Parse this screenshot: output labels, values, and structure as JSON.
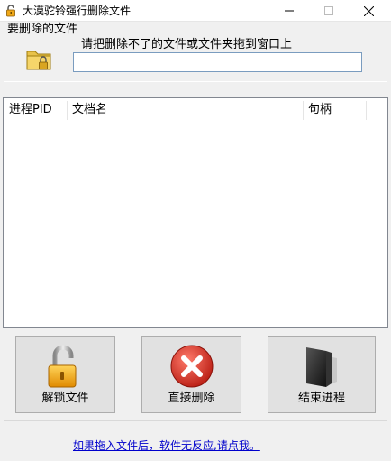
{
  "window": {
    "title": "大漠驼铃强行删除文件",
    "icon": "unlocked-padlock-icon"
  },
  "file_group": {
    "label": "要删除的文件",
    "hint": "请把删除不了的文件或文件夹拖到窗口上",
    "path_value": "",
    "folder_icon": "folder-lock-icon"
  },
  "table": {
    "columns": [
      "进程PID",
      "文档名",
      "句柄"
    ],
    "rows": []
  },
  "buttons": {
    "unlock_label": "解锁文件",
    "delete_label": "直接删除",
    "kill_label": "结束进程"
  },
  "help_link": "如果拖入文件后，软件无反应,请点我。",
  "colors": {
    "link": "#0000cc",
    "delete_red": "#d83a2e",
    "lock_gold": "#f0a818"
  }
}
